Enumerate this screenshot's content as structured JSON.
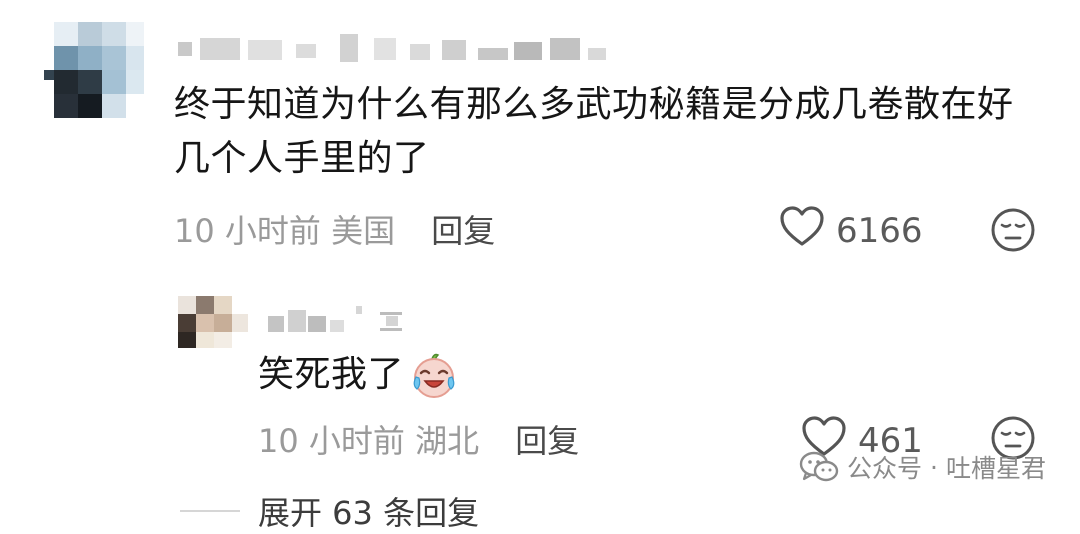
{
  "comment1": {
    "text_line1": "终于知道为什么有那么多武功秘籍是分成几卷散在好",
    "text_line2": "几个人手里的了",
    "time": "10 小时前",
    "location": "美国",
    "reply_label": "回复",
    "likes": "6166"
  },
  "reply1": {
    "text": "笑死我了",
    "emoji": "laughing-crying-emoji",
    "time": "10 小时前",
    "location": "湖北",
    "reply_label": "回复",
    "likes": "461"
  },
  "expand_replies": {
    "label": "展开 63 条回复"
  },
  "watermark": {
    "prefix": "公众号",
    "separator": "·",
    "name": "吐槽星君"
  },
  "icons": {
    "heart": "heart-outline-icon",
    "face": "neutral-face-icon",
    "wechat": "wechat-logo-icon"
  }
}
